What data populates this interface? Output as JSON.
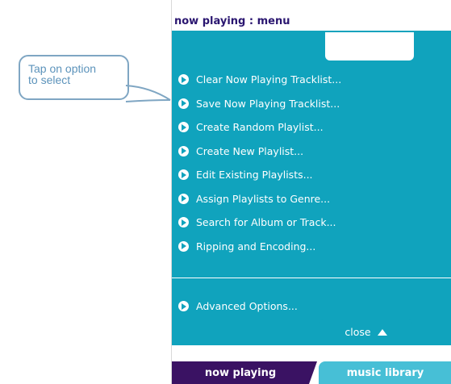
{
  "callout": {
    "line1": "Tap on option",
    "line2": "to select"
  },
  "header": {
    "title": "now playing : menu"
  },
  "menu": {
    "items": [
      {
        "label": "Clear Now Playing Tracklist..."
      },
      {
        "label": "Save Now Playing Tracklist..."
      },
      {
        "label": "Create Random Playlist..."
      },
      {
        "label": "Create New Playlist..."
      },
      {
        "label": "Edit Existing Playlists..."
      },
      {
        "label": "Assign Playlists to Genre..."
      },
      {
        "label": "Search for Album or Track..."
      },
      {
        "label": "Ripping and Encoding..."
      }
    ],
    "advanced": "Advanced Options..."
  },
  "close": {
    "label": "close"
  },
  "tabs": {
    "now_playing": "now playing",
    "music_library": "music library"
  },
  "colors": {
    "teal": "#10a3bd",
    "purple": "#3a1263",
    "light_teal": "#47bfd6",
    "callout": "#7fa6c3"
  }
}
